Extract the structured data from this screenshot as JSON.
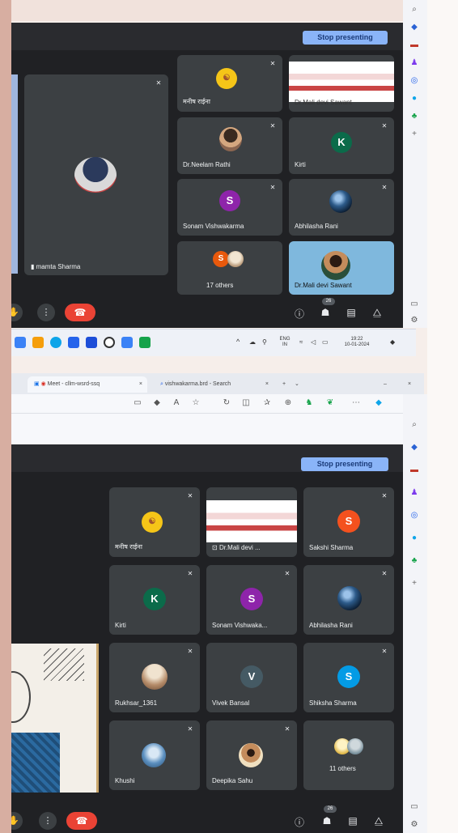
{
  "top": {
    "stop_presenting": "Stop presenting",
    "presenter_name": "mamta Sharma",
    "tiles": [
      {
        "name": "मनीष राईना",
        "avatar_letter": "",
        "avatar_color": "#f5c518"
      },
      {
        "name": "Dr.Mali devi Sawant",
        "avatar_letter": "",
        "avatar_color": "#ffffff"
      },
      {
        "name": "Dr.Neelam Rathi",
        "avatar_letter": "",
        "avatar_color": "#7a5b45"
      },
      {
        "name": "Kirti",
        "avatar_letter": "K",
        "avatar_color": "#0b6b4a"
      },
      {
        "name": "Sonam Vishwakarma",
        "avatar_letter": "S",
        "avatar_color": "#8e24aa"
      },
      {
        "name": "Abhilasha Rani",
        "avatar_letter": "",
        "avatar_color": "#2d5b8a"
      },
      {
        "name": "17 others",
        "avatar_letter": "S",
        "avatar_color": "#e8590c"
      },
      {
        "name": "Dr.Mali devi Sawant",
        "avatar_letter": "",
        "avatar_color": "#c9a16a"
      }
    ],
    "participant_count": "26",
    "taskbar": {
      "lang_line1": "ENG",
      "lang_line2": "IN",
      "time": "19:22",
      "date": "10-01-2024"
    }
  },
  "browser": {
    "tab1_label": "Meet - cllm-wsrd-ssq",
    "tab2_label": "vishwakarma.brd - Search"
  },
  "bottom": {
    "stop_presenting": "Stop presenting",
    "tiles": [
      {
        "name": "मनीष राईना",
        "avatar_letter": "",
        "avatar_color": "#f5c518"
      },
      {
        "name": "Dr.Mali devi ...",
        "avatar_letter": "",
        "avatar_color": "#ffffff"
      },
      {
        "name": "Sakshi Sharma",
        "avatar_letter": "S",
        "avatar_color": "#f4511e"
      },
      {
        "name": "Kirti",
        "avatar_letter": "K",
        "avatar_color": "#0b6b4a"
      },
      {
        "name": "Sonam Vishwaka...",
        "avatar_letter": "S",
        "avatar_color": "#8e24aa"
      },
      {
        "name": "Abhilasha Rani",
        "avatar_letter": "",
        "avatar_color": "#2d5b8a"
      },
      {
        "name": "Rukhsar_1361",
        "avatar_letter": "",
        "avatar_color": "#b58c6a"
      },
      {
        "name": "Vivek Bansal",
        "avatar_letter": "V",
        "avatar_color": "#455a64"
      },
      {
        "name": "Shiksha Sharma",
        "avatar_letter": "S",
        "avatar_color": "#039be5"
      },
      {
        "name": "Khushi",
        "avatar_letter": "",
        "avatar_color": "#5b8fbf"
      },
      {
        "name": "Deepika Sahu",
        "avatar_letter": "",
        "avatar_color": "#c48c5c"
      },
      {
        "name": "11 others",
        "avatar_letter": "",
        "avatar_color": "#e0b84a"
      }
    ],
    "participant_count": "26"
  }
}
